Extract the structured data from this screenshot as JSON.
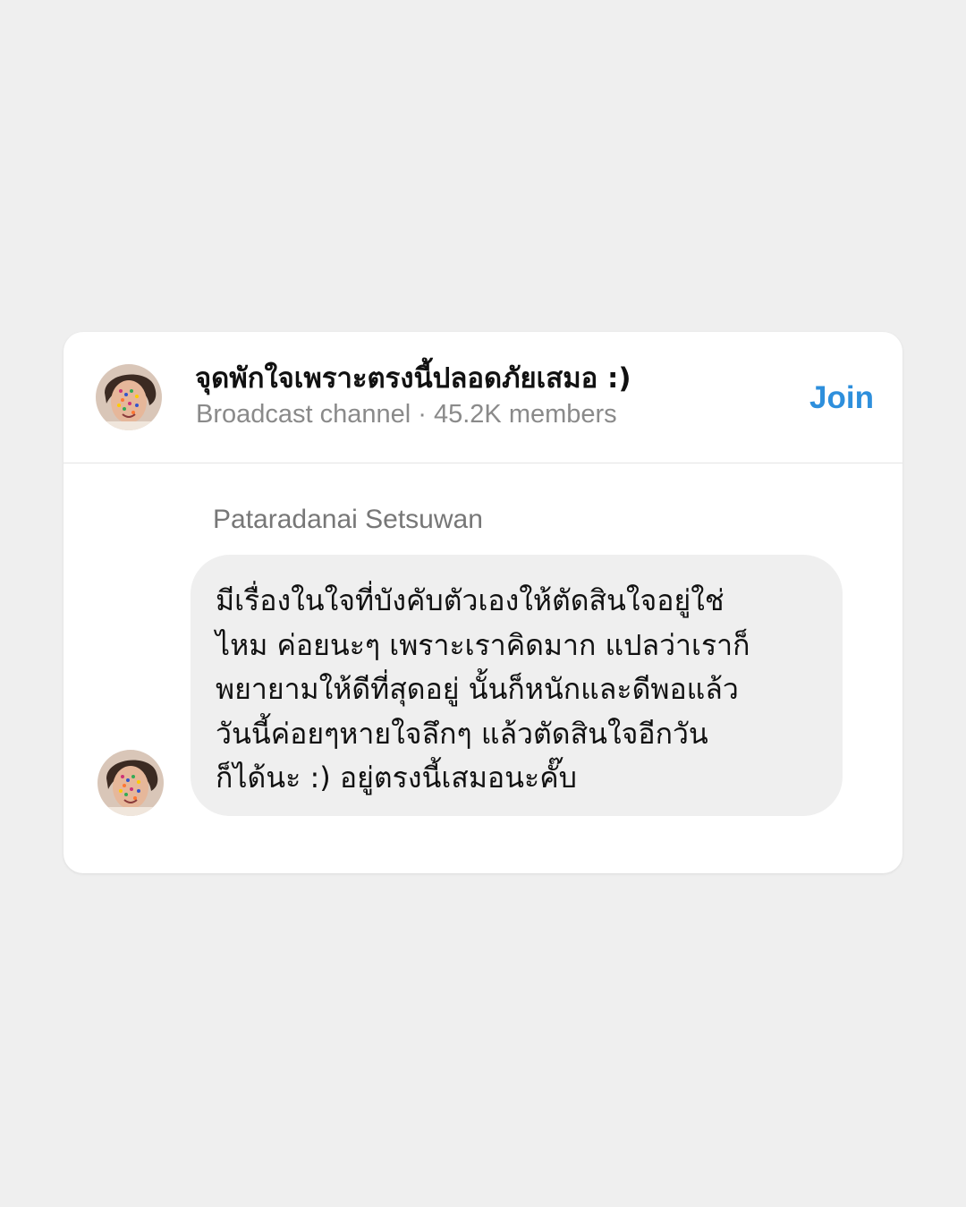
{
  "channel": {
    "title": "จุดพักใจเพราะตรงนี้ปลอดภัยเสมอ :)",
    "subtitle": "Broadcast channel · 45.2K members",
    "join_label": "Join"
  },
  "message": {
    "sender": "Pataradanai Setsuwan",
    "text": "มีเรื่องในใจที่บังคับตัวเองให้ตัดสินใจอยู่ใช่\nไหม ค่อยนะๆ เพราะเราคิดมาก แปลว่าเราก็\nพยายามให้ดีที่สุดอยู่ นั้นก็หนักและดีพอแล้ว\nวันนี้ค่อยๆหายใจลึกๆ แล้วตัดสินใจอีกวัน\nก็ได้นะ :) อยู่ตรงนี้เสมอนะคั๊บ"
  },
  "colors": {
    "page_background": "#efefef",
    "card_background": "#ffffff",
    "bubble_background": "#efefef",
    "accent": "#2e8fdc",
    "secondary_text": "#8a8a8a"
  },
  "icons": {
    "channel_avatar": "profile-photo-avatar",
    "message_avatar": "profile-photo-avatar"
  }
}
